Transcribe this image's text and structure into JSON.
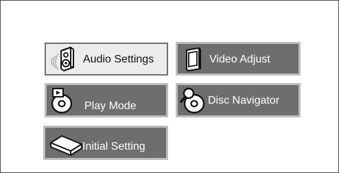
{
  "menu": {
    "selected": "audio",
    "items": [
      {
        "id": "audio",
        "label": "Audio Settings",
        "icon": "speaker-icon"
      },
      {
        "id": "video",
        "label": "Video Adjust",
        "icon": "monitor-icon"
      },
      {
        "id": "play",
        "label": "Play Mode",
        "icon": "disc-play-icon"
      },
      {
        "id": "disc",
        "label": "Disc Navigator",
        "icon": "disc-search-icon"
      },
      {
        "id": "init",
        "label": "Initial Setting",
        "icon": "settings-box-icon"
      }
    ]
  },
  "colors": {
    "button_bg": "#6e6e6e",
    "button_border": "#bdbdbd",
    "selected_bg": "#ececec",
    "frame": "#4a4a4a"
  }
}
